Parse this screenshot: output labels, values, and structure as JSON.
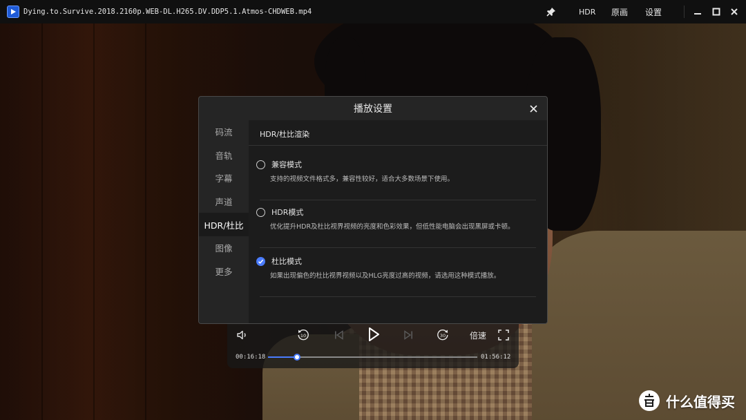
{
  "window": {
    "file_title": "Dying.to.Survive.2018.2160p.WEB-DL.H265.DV.DDP5.1.Atmos-CHDWEB.mp4",
    "hdr_label": "HDR",
    "original_label": "原画",
    "settings_label": "设置"
  },
  "dialog": {
    "title": "播放设置",
    "sidebar": [
      {
        "label": "码流"
      },
      {
        "label": "音轨"
      },
      {
        "label": "字幕"
      },
      {
        "label": "声道"
      },
      {
        "label": "HDR/杜比"
      },
      {
        "label": "图像"
      },
      {
        "label": "更多"
      }
    ],
    "active_tab_index": 4,
    "section_title": "HDR/杜比渲染",
    "options": [
      {
        "label": "兼容模式",
        "description": "支持的视频文件格式多，兼容性较好，适合大多数场景下使用。",
        "selected": false
      },
      {
        "label": "HDR模式",
        "description": "优化提升HDR及杜比视界视频的亮度和色彩效果，但低性能电脑会出现黑屏或卡顿。",
        "selected": false
      },
      {
        "label": "杜比模式",
        "description": "如果出现偏色的杜比视界视频以及HLG亮度过高的视频，请选用这种模式播放。",
        "selected": true
      }
    ]
  },
  "player": {
    "speed_label": "倍速",
    "current_time": "00:16:18",
    "total_time": "01:56:12",
    "progress": 0.14
  },
  "watermark": {
    "text": "什么值得买",
    "icon": "zhi-icon"
  },
  "colors": {
    "accent": "#4a7cff",
    "dialog_bg": "#252525",
    "content_bg": "#1c1c1c"
  }
}
